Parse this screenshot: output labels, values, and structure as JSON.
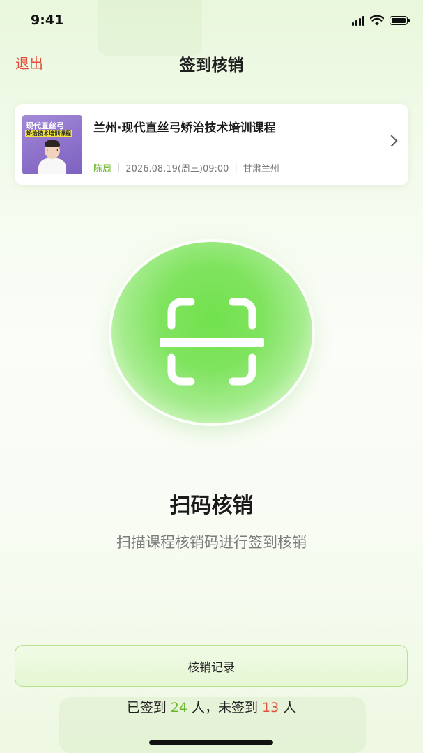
{
  "status_bar": {
    "time": "9:41"
  },
  "nav": {
    "back_label": "退出",
    "title": "签到核销"
  },
  "course": {
    "cover_line1": "现代直丝弓",
    "cover_line2": "矫治技术培训课程",
    "title": "兰州·现代直丝弓矫治技术培训课程",
    "teacher": "陈周",
    "datetime": "2026.08.19(周三)09:00",
    "location": "甘肃兰州"
  },
  "scan": {
    "title": "扫码核销",
    "subtitle": "扫描课程核销码进行签到核销"
  },
  "record": {
    "label": "核销记录"
  },
  "stats": {
    "checked_prefix": "已签到",
    "checked_count": "24",
    "checked_unit": "人，未签到",
    "unchecked_count": "13",
    "unchecked_unit": "人"
  },
  "colors": {
    "accent_green": "#6cb62f",
    "accent_red": "#e2513c",
    "scan_green": "#72e24e"
  },
  "icons": [
    "signal-icon",
    "wifi-icon",
    "battery-icon",
    "chevron-right-icon",
    "scan-icon"
  ]
}
